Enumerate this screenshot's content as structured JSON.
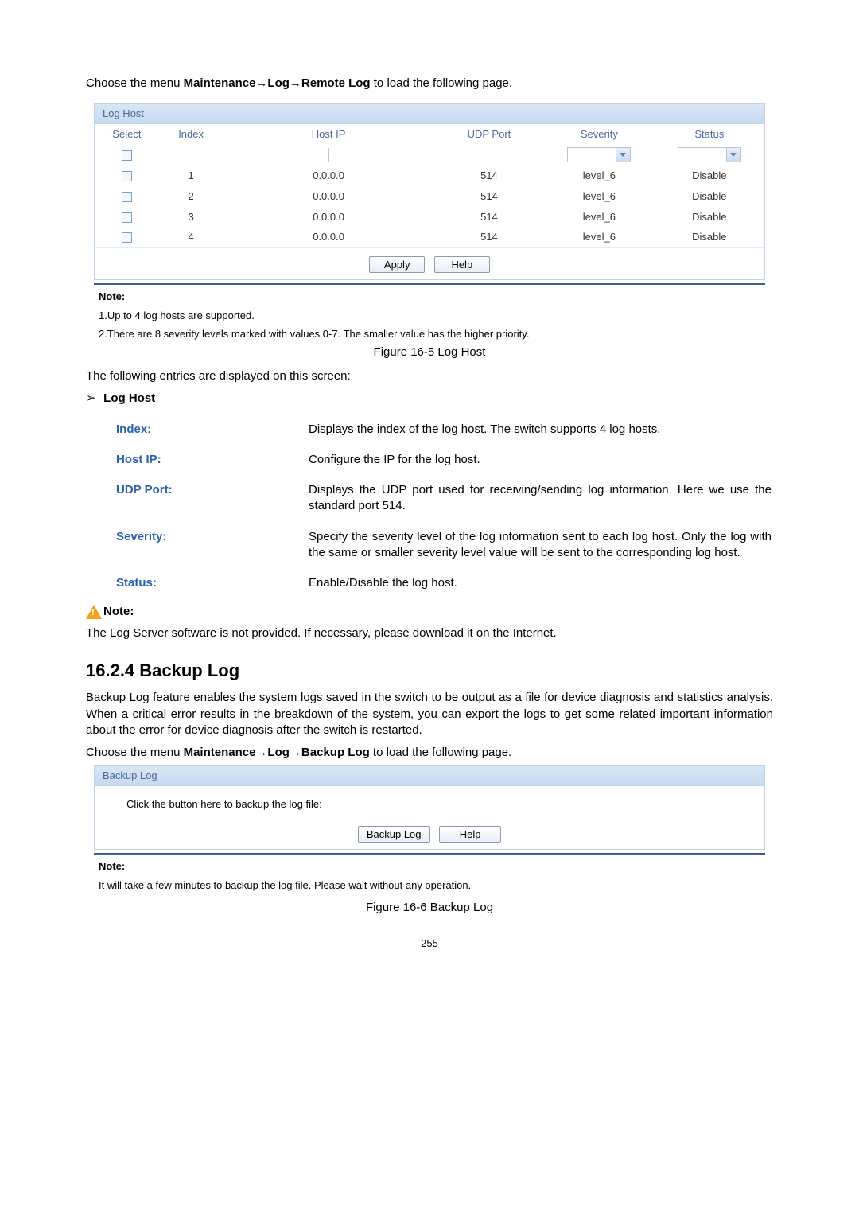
{
  "intro1_prefix": "Choose the menu ",
  "intro1_bold": "Maintenance→Log→Remote Log",
  "intro1_suffix": " to load the following page.",
  "log_host_panel": {
    "title": "Log Host",
    "headers": {
      "select": "Select",
      "index": "Index",
      "hostip": "Host IP",
      "udpport": "UDP Port",
      "severity": "Severity",
      "status": "Status"
    },
    "rows": [
      {
        "index": "1",
        "hostip": "0.0.0.0",
        "udpport": "514",
        "severity": "level_6",
        "status": "Disable"
      },
      {
        "index": "2",
        "hostip": "0.0.0.0",
        "udpport": "514",
        "severity": "level_6",
        "status": "Disable"
      },
      {
        "index": "3",
        "hostip": "0.0.0.0",
        "udpport": "514",
        "severity": "level_6",
        "status": "Disable"
      },
      {
        "index": "4",
        "hostip": "0.0.0.0",
        "udpport": "514",
        "severity": "level_6",
        "status": "Disable"
      }
    ],
    "apply": "Apply",
    "help": "Help"
  },
  "note_label": "Note:",
  "note1_line1": "1.Up to 4 log hosts are supported.",
  "note1_line2": "2.There are 8 severity levels marked with values 0-7. The smaller value has the higher priority.",
  "fig1": "Figure 16-5 Log Host",
  "entries_intro": "The following entries are displayed on this screen:",
  "log_host_heading": "Log Host",
  "defs": {
    "index": {
      "label": "Index:",
      "text": "Displays the index of the log host. The switch supports 4 log hosts."
    },
    "hostip": {
      "label": "Host IP:",
      "text": "Configure the IP for the log host."
    },
    "udpport": {
      "label": "UDP Port:",
      "text": "Displays the UDP port used for receiving/sending log information. Here we use the standard port 514."
    },
    "severity": {
      "label": "Severity:",
      "text": "Specify the severity level of the log information sent to each log host. Only the log with the same or smaller severity level value will be sent to the corresponding log host."
    },
    "status": {
      "label": "Status:",
      "text": "Enable/Disable the log host."
    }
  },
  "note2_text": "The Log Server software is not provided. If necessary, please download it on the Internet.",
  "section_heading": "16.2.4  Backup Log",
  "backup_intro": "Backup Log feature enables the system logs saved in the switch to be output as a file for device diagnosis and statistics analysis. When a critical error results in the breakdown of the system, you can export the logs to get some related important information about the error for device diagnosis after the switch is restarted.",
  "intro2_prefix": "Choose the menu ",
  "intro2_bold": "Maintenance→Log→Backup Log",
  "intro2_suffix": " to load the following page.",
  "backup_panel": {
    "title": "Backup Log",
    "text": "Click the button here to backup the log file:",
    "backup_btn": "Backup Log",
    "help_btn": "Help"
  },
  "note3_text": "It will take a few minutes to backup the log file. Please wait without any operation.",
  "fig2": "Figure 16-6 Backup Log",
  "page_number": "255"
}
